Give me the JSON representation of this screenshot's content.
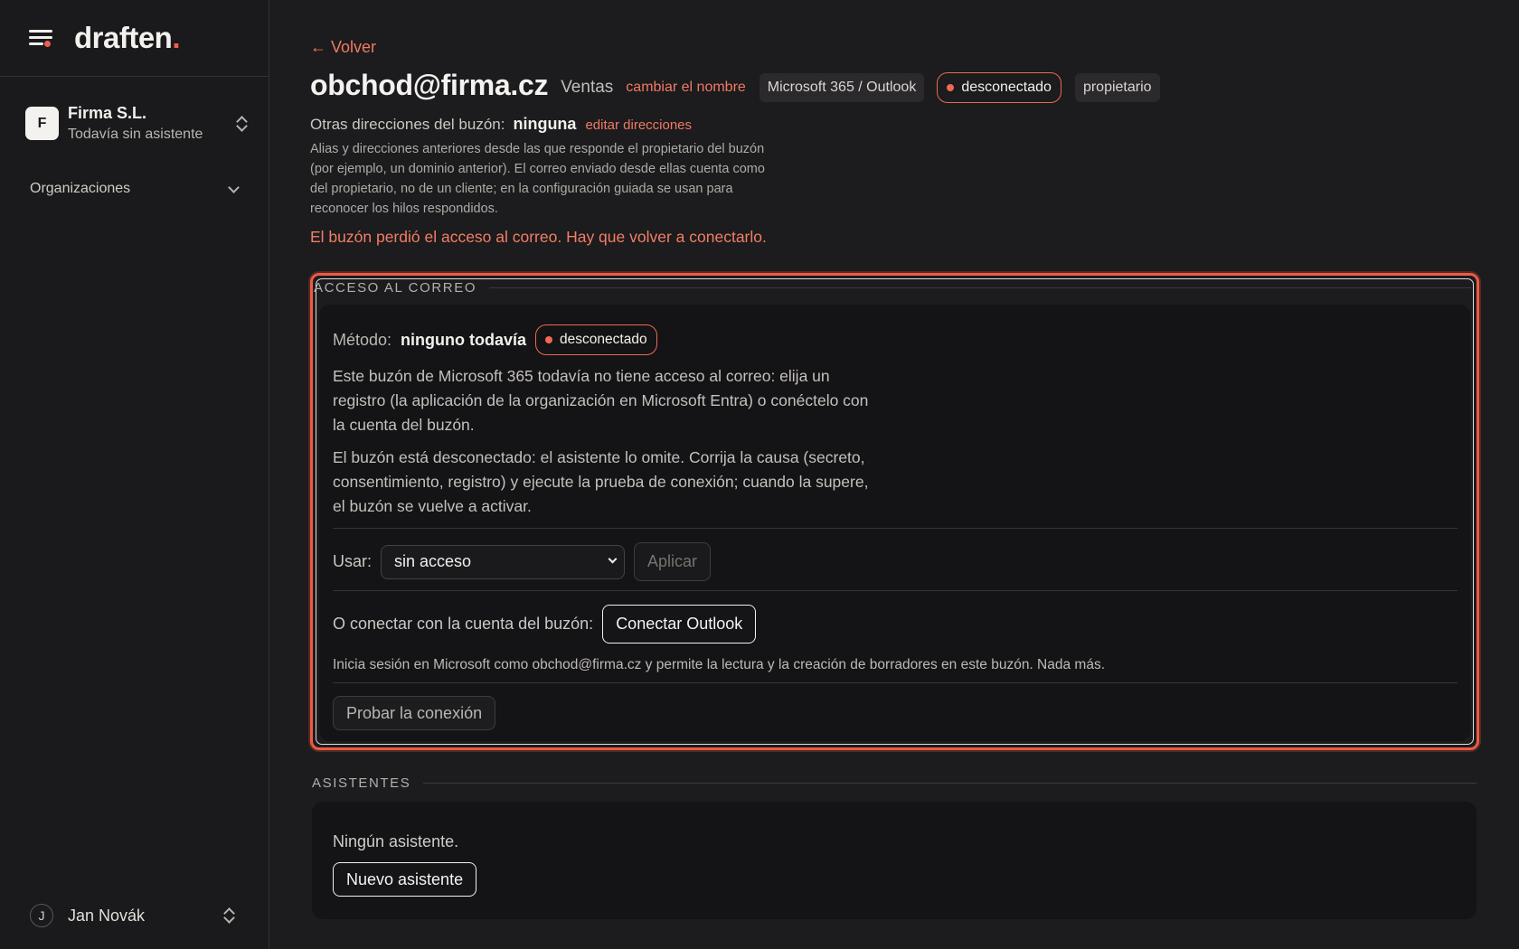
{
  "sidebar": {
    "logo": "draften",
    "logo_dot": ".",
    "org": {
      "initial": "F",
      "name": "Firma S.L.",
      "subtitle": "Todavía sin asistente"
    },
    "nav_section": "Organizaciones",
    "user": {
      "initial": "J",
      "name": "Jan Novák"
    }
  },
  "header": {
    "back": "← Volver",
    "mailbox": "obchod@firma.cz",
    "team": "Ventas",
    "rename": "cambiar el nombre",
    "provider": "Microsoft 365 / Outlook",
    "status": "desconectado",
    "role": "propietario"
  },
  "aliases": {
    "label": "Otras direcciones del buzón:",
    "value": "ninguna",
    "edit": "editar direcciones",
    "help": "Alias y direcciones anteriores desde las que responde el propietario del buzón (por ejemplo, un dominio anterior). El correo enviado desde ellas cuenta como del propietario, no de un cliente; en la configuración guiada se usan para reconocer los hilos respondidos."
  },
  "error_message": "El buzón perdió el acceso al correo. Hay que volver a conectarlo.",
  "access": {
    "section_title": "ACCESO AL CORREO",
    "method_label": "Método:",
    "method_value": "ninguno todavía",
    "status": "desconectado",
    "para1": "Este buzón de Microsoft 365 todavía no tiene acceso al correo: elija un registro (la aplicación de la organización en Microsoft Entra) o conéctelo con la cuenta del buzón.",
    "para2": "El buzón está desconectado: el asistente lo omite. Corrija la causa (secreto, consentimiento, registro) y ejecute la prueba de conexión; cuando la supere, el buzón se vuelve a activar.",
    "use_label": "Usar:",
    "use_selected": "sin acceso",
    "apply": "Aplicar",
    "connect_label": "O conectar con la cuenta del buzón:",
    "connect_button": "Conectar Outlook",
    "connect_help": "Inicia sesión en Microsoft como obchod@firma.cz y permite la lectura y la creación de borradores en este buzón. Nada más.",
    "test_button": "Probar la conexión"
  },
  "assistants": {
    "section_title": "ASISTENTES",
    "empty": "Ningún asistente.",
    "new_button": "Nuevo asistente"
  },
  "colors": {
    "accent": "#ef5f4a",
    "link": "#f07a63",
    "background": "#1c1b1d",
    "card": "#141315"
  }
}
